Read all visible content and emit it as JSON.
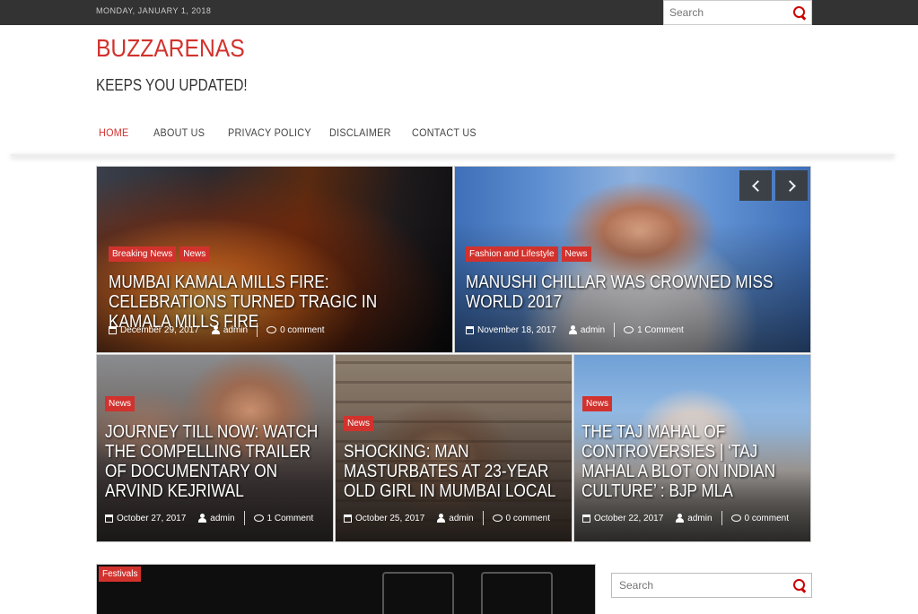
{
  "topbar": {
    "date": "Monday, January 1, 2018",
    "search_placeholder": "Search"
  },
  "site": {
    "title": "BUZZARENAS",
    "tagline": "KEEPS YOU UPDATED!"
  },
  "nav": {
    "items": [
      {
        "label": "HOME"
      },
      {
        "label": "ABOUT US"
      },
      {
        "label": "PRIVACY POLICY"
      },
      {
        "label": "DISCLAIMER"
      },
      {
        "label": "CONTACT US"
      }
    ]
  },
  "slider": {
    "posts": [
      {
        "categories": [
          "Breaking News",
          "News"
        ],
        "title": "Mumbai Kamala Mills Fire: Celebrations turned tragic in Kamala Mills Fire",
        "date": "December 29, 2017",
        "author": "admin",
        "comments": "0 comment"
      },
      {
        "categories": [
          "Fashion and Lifestyle",
          "News"
        ],
        "title": "Manushi Chillar was crowned Miss World 2017",
        "date": "November 18, 2017",
        "author": "admin",
        "comments": "1 Comment"
      }
    ]
  },
  "grid": {
    "posts": [
      {
        "categories": [
          "News"
        ],
        "title": "Journey till now: Watch the compelling trailer of documentary on Arvind Kejriwal",
        "date": "October 27, 2017",
        "author": "admin",
        "comments": "1 Comment"
      },
      {
        "categories": [
          "News"
        ],
        "title": "Shocking: Man Masturbates at 23-year old girl in Mumbai local",
        "date": "October 25, 2017",
        "author": "admin",
        "comments": "0 comment"
      },
      {
        "categories": [
          "News"
        ],
        "title": "The Taj Mahal of controversies | ‘Taj Mahal a blot on Indian culture’ : BJP MLA",
        "date": "October 22, 2017",
        "author": "admin",
        "comments": "0 comment"
      }
    ]
  },
  "bottom": {
    "category": "Festivals",
    "sidebar_search_placeholder": "Search"
  },
  "colors": {
    "accent": "#d2322d",
    "topbar": "#333333"
  }
}
